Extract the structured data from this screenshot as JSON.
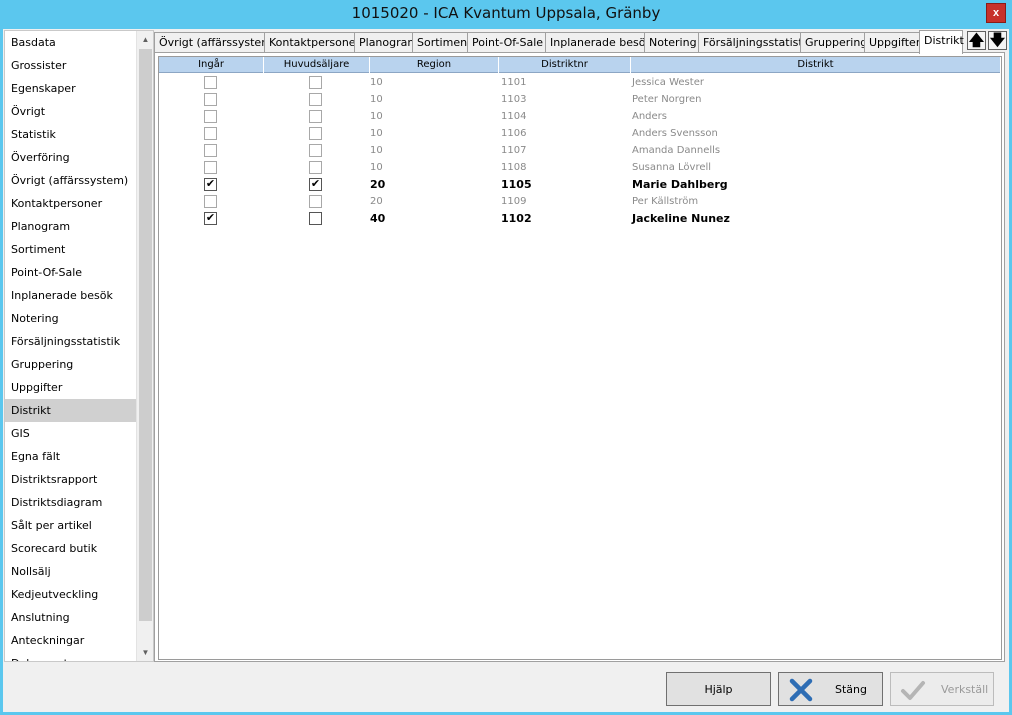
{
  "window": {
    "title": "1015020 - ICA Kvantum Uppsala, Gränby",
    "close": "x"
  },
  "sidebar": {
    "active": "Distrikt",
    "items": [
      "Basdata",
      "Grossister",
      "Egenskaper",
      "Övrigt",
      "Statistik",
      "Överföring",
      "Övrigt (affärssystem)",
      "Kontaktpersoner",
      "Planogram",
      "Sortiment",
      "Point-Of-Sale",
      "Inplanerade besök",
      "Notering",
      "Försäljningsstatistik",
      "Gruppering",
      "Uppgifter",
      "Distrikt",
      "GIS",
      "Egna fält",
      "Distriktsrapport",
      "Distriktsdiagram",
      "Sålt per artikel",
      "Scorecard butik",
      "Nollsälj",
      "Kedjeutveckling",
      "Anslutning",
      "Anteckningar",
      "Dokument"
    ]
  },
  "tabs": {
    "items": [
      "Övrigt (affärssystem)",
      "Kontaktpersoner",
      "Planogram",
      "Sortiment",
      "Point-Of-Sale",
      "Inplanerade besök",
      "Notering",
      "Försäljningsstatistik",
      "Gruppering",
      "Uppgifter",
      "Distrikt"
    ],
    "active": "Distrikt",
    "up_arrow": "🡅",
    "down_arrow": "🡇"
  },
  "grid": {
    "columns": [
      "Ingår",
      "Huvudsäljare",
      "Region",
      "Distriktnr",
      "Distrikt"
    ],
    "rows": [
      {
        "ingar": false,
        "huvud": false,
        "region": "10",
        "nr": "1101",
        "distrikt": "Jessica Wester",
        "bold": false
      },
      {
        "ingar": false,
        "huvud": false,
        "region": "10",
        "nr": "1103",
        "distrikt": "Peter Norgren",
        "bold": false
      },
      {
        "ingar": false,
        "huvud": false,
        "region": "10",
        "nr": "1104",
        "distrikt": "Anders",
        "bold": false
      },
      {
        "ingar": false,
        "huvud": false,
        "region": "10",
        "nr": "1106",
        "distrikt": "Anders Svensson",
        "bold": false
      },
      {
        "ingar": false,
        "huvud": false,
        "region": "10",
        "nr": "1107",
        "distrikt": "Amanda Dannells",
        "bold": false
      },
      {
        "ingar": false,
        "huvud": false,
        "region": "10",
        "nr": "1108",
        "distrikt": "Susanna Lövrell",
        "bold": false
      },
      {
        "ingar": true,
        "huvud": true,
        "region": "20",
        "nr": "1105",
        "distrikt": "Marie Dahlberg",
        "bold": true
      },
      {
        "ingar": false,
        "huvud": false,
        "region": "20",
        "nr": "1109",
        "distrikt": "Per Källström",
        "bold": false
      },
      {
        "ingar": true,
        "huvud": false,
        "region": "40",
        "nr": "1102",
        "distrikt": "Jackeline Nunez",
        "bold": true
      }
    ],
    "check_glyph": "✔"
  },
  "buttons": {
    "help": "Hjälp",
    "close": "Stäng",
    "apply": "Verkställ",
    "apply_enabled": false
  },
  "colors": {
    "titlebar": "#5bc7ee",
    "header": "#b9d3ee",
    "close": "#c7312a",
    "close_icon": "#2e6db4"
  }
}
